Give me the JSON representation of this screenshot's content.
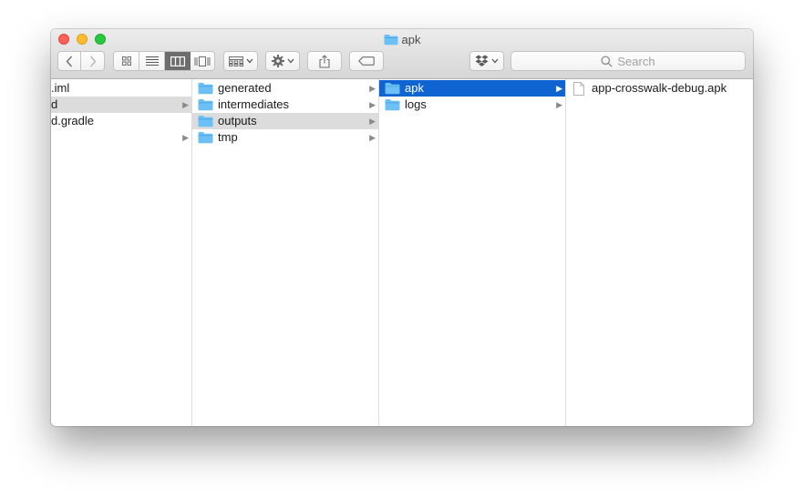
{
  "window": {
    "title": "apk"
  },
  "toolbar": {
    "search_placeholder": "Search"
  },
  "columns": [
    {
      "rows": [
        {
          "label": ".iml",
          "has_children": false,
          "state": "normal"
        },
        {
          "label": "d",
          "has_children": true,
          "state": "path"
        },
        {
          "label": "d.gradle",
          "has_children": false,
          "state": "normal"
        },
        {
          "label": "",
          "has_children": true,
          "state": "normal"
        }
      ]
    },
    {
      "rows": [
        {
          "label": "generated",
          "has_children": true,
          "state": "normal"
        },
        {
          "label": "intermediates",
          "has_children": true,
          "state": "normal"
        },
        {
          "label": "outputs",
          "has_children": true,
          "state": "path"
        },
        {
          "label": "tmp",
          "has_children": true,
          "state": "normal"
        }
      ]
    },
    {
      "rows": [
        {
          "label": "apk",
          "has_children": true,
          "state": "selected"
        },
        {
          "label": "logs",
          "has_children": true,
          "state": "normal"
        }
      ]
    },
    {
      "rows": [
        {
          "label": "app-crosswalk-debug.apk",
          "type": "file"
        }
      ]
    }
  ],
  "colors": {
    "selection": "#0f64d2",
    "path_highlight": "#dcdcdc",
    "folder": "#6cc0f5"
  }
}
